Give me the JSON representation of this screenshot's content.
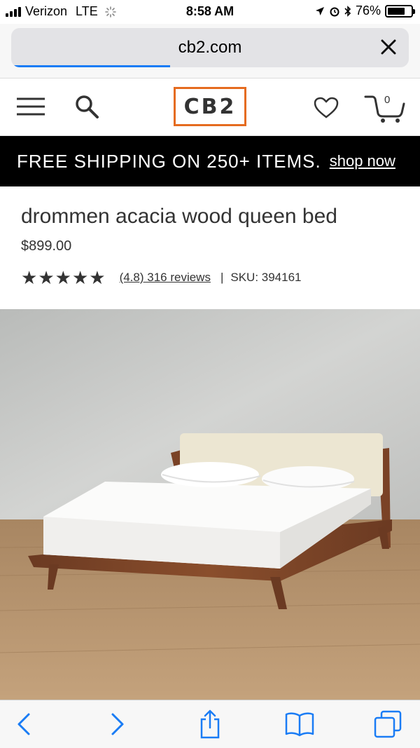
{
  "status_bar": {
    "carrier": "Verizon",
    "network": "LTE",
    "time": "8:58 AM",
    "battery_percent": "76%",
    "battery_level": 0.76
  },
  "browser": {
    "url": "cb2.com",
    "load_progress": 0.4
  },
  "header": {
    "logo": "CB2",
    "cart_count": "0",
    "icons": [
      "menu-icon",
      "search-icon",
      "heart-icon",
      "cart-icon"
    ]
  },
  "promo": {
    "text": "FREE SHIPPING ON 250+ ITEMS.",
    "link": "shop now"
  },
  "product": {
    "title": "drommen acacia wood queen bed",
    "price": "$899.00",
    "rating_stars": 5,
    "reviews_text": "(4.8) 316 reviews",
    "separator": "|",
    "sku": "SKU: 394161"
  },
  "toolbar": {
    "icons": [
      "back-icon",
      "forward-icon",
      "share-icon",
      "bookmarks-icon",
      "tabs-icon"
    ]
  },
  "colors": {
    "accent": "#e56b1f",
    "link_blue": "#1a7cf5",
    "banner_bg": "#000000"
  }
}
